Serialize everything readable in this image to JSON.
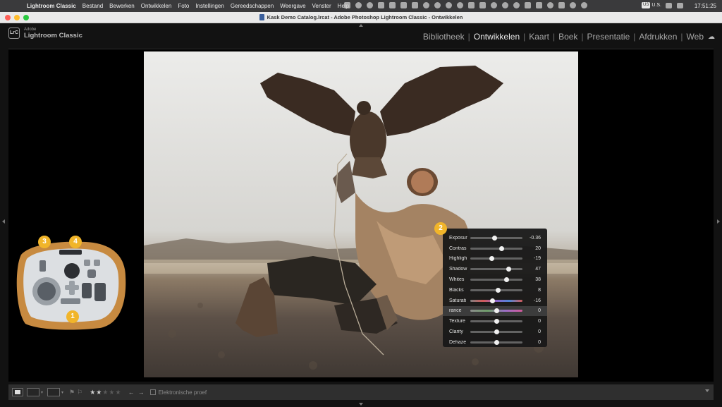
{
  "menubar": {
    "app_name": "Lightroom Classic",
    "items": [
      "Bestand",
      "Bewerken",
      "Ontwikkelen",
      "Foto",
      "Instellingen",
      "Gereedschappen",
      "Weergave",
      "Venster",
      "Help"
    ],
    "input_source": "U.S.",
    "input_flag": "US",
    "clock": "17:51:25"
  },
  "window": {
    "title": "Kask Demo Catalog.lrcat - Adobe Photoshop Lightroom Classic - Ontwikkelen"
  },
  "identity_plate": {
    "badge": "LrC",
    "vendor": "Adobe",
    "product": "Lightroom Classic"
  },
  "modules": {
    "active": "Ontwikkelen",
    "items": [
      "Bibliotheek",
      "Ontwikkelen",
      "Kaart",
      "Boek",
      "Presentatie",
      "Afdrukken",
      "Web"
    ]
  },
  "develop_panel": {
    "badge": "2",
    "sliders": [
      {
        "label": "Exposur",
        "value": "-0.36",
        "position": 0.47,
        "track": "plain"
      },
      {
        "label": "Contras",
        "value": "20",
        "position": 0.6,
        "track": "plain"
      },
      {
        "label": "Highligh",
        "value": "-19",
        "position": 0.41,
        "track": "plain"
      },
      {
        "label": "Shadow",
        "value": "47",
        "position": 0.74,
        "track": "plain"
      },
      {
        "label": "Whites",
        "value": "38",
        "position": 0.69,
        "track": "plain"
      },
      {
        "label": "Blacks",
        "value": "8",
        "position": 0.54,
        "track": "plain"
      },
      {
        "label": "Saturati",
        "value": "-16",
        "position": 0.42,
        "track": "saturation"
      },
      {
        "label": "rance",
        "value": "0",
        "position": 0.5,
        "track": "vibrance",
        "highlighted": true
      },
      {
        "label": "Texture",
        "value": "0",
        "position": 0.5,
        "track": "plain"
      },
      {
        "label": "Clarity",
        "value": "0",
        "position": 0.5,
        "track": "plain"
      },
      {
        "label": "Dehaze",
        "value": "0",
        "position": 0.5,
        "track": "plain"
      }
    ]
  },
  "console_badges": {
    "top_left": "3",
    "top_center": "4",
    "bottom": "1"
  },
  "toolbar": {
    "rating_stars": "★★★★★",
    "rating_value": 2,
    "soft_proof_label": "Elektronische proef"
  },
  "colors": {
    "badge": "#f1b52a",
    "active_module": "#e9e9e9",
    "inactive_module": "#a7a7a7",
    "panel_bg": "#181818"
  }
}
